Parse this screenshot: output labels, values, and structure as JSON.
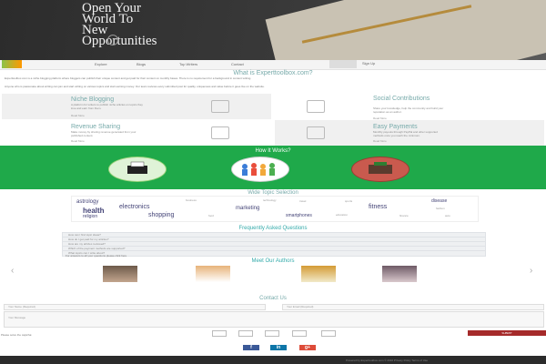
{
  "hero": {
    "title": "Open Your\nWorld To\nNew\nOpportunities"
  },
  "nav": {
    "items": [
      "Explore",
      "Blogs",
      "Top Writers",
      "Contact"
    ],
    "signup": "Sign Up"
  },
  "about": {
    "title": "What is Experttoolbox.com?",
    "p1": "Experttoolbox.com is a niche blogging platform where bloggers can publish their unique content and get paid for their content on monthly bases. There is no requirement for a background in content writing.",
    "p2": "Anyone who is passionate about writing can join and start writing on various topics and start earning money. Our team reviews every submitted post for quality, uniqueness and value before it goes live on the website."
  },
  "features": [
    {
      "title": "Niche Blogging",
      "desc": "A platform for writers to publish niche articles on topics they love and earn from them.",
      "more": "Read More"
    },
    {
      "title": "Social Contributions",
      "desc": "Share your knowledge, help the community and build your reputation as an author.",
      "more": "Read More"
    },
    {
      "title": "Revenue Sharing",
      "desc": "Make money by sharing revenue generated from your published content.",
      "more": "Read More"
    },
    {
      "title": "Easy Payments",
      "desc": "Monthly payouts through PayPal and other supported methods once you reach the minimum.",
      "more": "Read More"
    }
  ],
  "how": {
    "title": "How It Works?"
  },
  "topics": {
    "title": "Wide Topic Selection",
    "tags": [
      "astrology",
      "electronics",
      "health",
      "marketing",
      "fitness",
      "disease",
      "religion",
      "shopping",
      "smartphones",
      "business",
      "travel",
      "education",
      "finance",
      "technology",
      "food",
      "sports",
      "fashion",
      "auto"
    ]
  },
  "faq": {
    "title": "Frequently Asked Questions",
    "questions": [
      "How can I find topic ideas?",
      "How do I get paid for my articles?",
      "How are my articles reviewed?",
      "Which of the payment methods are supported?",
      "What topics can I write about?"
    ],
    "more": "For answers to all your questions please click here"
  },
  "authors": {
    "title": "Meet Our Authors"
  },
  "contact": {
    "title": "Contact Us",
    "name_placeholder": "Your Name (Required)",
    "email_placeholder": "Your Email (Required)",
    "message_placeholder": "Your Message",
    "captcha_label": "Please solve the captcha:",
    "submit": "SUBMIT"
  },
  "social": {
    "facebook": "f",
    "linkedin": "in",
    "googleplus": "g+"
  },
  "footer": {
    "text": "Powered by Experttoolbox.com © 2016  Privacy Policy  Terms of Use"
  },
  "colors": {
    "green": "#1fa94a",
    "submit": "#a52a2a"
  }
}
